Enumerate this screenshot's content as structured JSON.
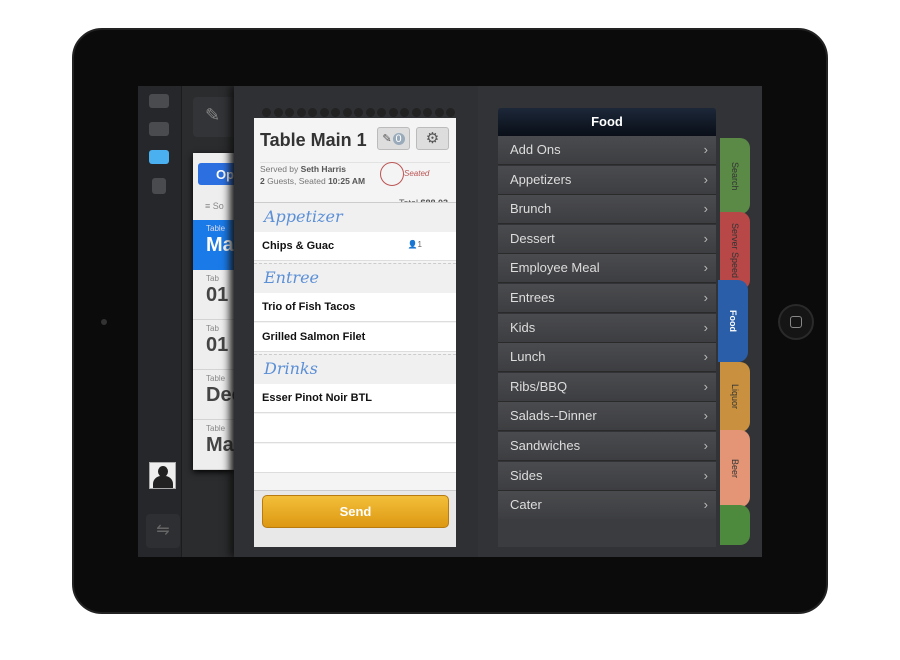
{
  "colors": {
    "accent_blue": "#2a5ea8",
    "send_button": "#e9a520",
    "handwriting": "#5b8fd6"
  },
  "sidebar": {
    "icons": [
      "home-icon",
      "table-icon",
      "eraser-icon",
      "drink-icon"
    ],
    "avatar": "user-avatar-icon",
    "bottom": "switch-icon"
  },
  "tabs_list": {
    "open_label": "Op",
    "sort_label": "So",
    "rows": [
      {
        "label": "Table",
        "value": "Ma"
      },
      {
        "label": "Tab",
        "value": "01"
      },
      {
        "label": "Tab",
        "value": "01"
      },
      {
        "label": "Table",
        "value": "Dec"
      },
      {
        "label": "Table",
        "value": "Ma"
      }
    ]
  },
  "order": {
    "title": "Table Main 1",
    "note_count": "0",
    "served_by_label": "Served by",
    "server": "Seth Harris",
    "guests": "2",
    "guests_label": "Guests, Seated",
    "seated_time": "10:25 AM",
    "status": "Seated",
    "total_label": "Total",
    "total": "$88.03",
    "sections": [
      {
        "name": "Appetizer",
        "items": [
          {
            "name": "Chips & Guac",
            "seat": "1"
          }
        ]
      },
      {
        "name": "Entree",
        "items": [
          {
            "name": "Trio of Fish Tacos"
          },
          {
            "name": "Grilled Salmon Filet"
          }
        ]
      },
      {
        "name": "Drinks",
        "items": [
          {
            "name": "Esser Pinot Noir BTL"
          }
        ]
      }
    ],
    "send_label": "Send"
  },
  "menu": {
    "title": "Food",
    "categories": [
      "Add Ons",
      "Appetizers",
      "Brunch",
      "Dessert",
      "Employee Meal",
      "Entrees",
      "Kids",
      "Lunch",
      "Ribs/BBQ",
      "Salads--Dinner",
      "Sandwiches",
      "Sides",
      "Cater"
    ]
  },
  "side_tabs": [
    {
      "label": "Search",
      "color": "#5a8a45"
    },
    {
      "label": "Server Speed",
      "color": "#b84848"
    },
    {
      "label": "Food",
      "color": "#2a5ea8",
      "active": true
    },
    {
      "label": "Liquor",
      "color": "#c9913f"
    },
    {
      "label": "Beer",
      "color": "#e39576"
    },
    {
      "label": "",
      "color": "#4d8a3d"
    }
  ]
}
